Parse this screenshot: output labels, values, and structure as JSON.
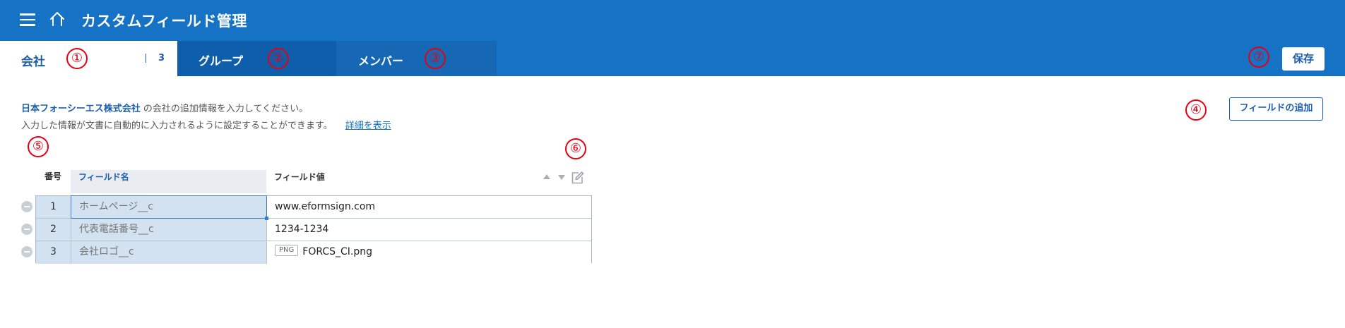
{
  "header": {
    "title": "カスタムフィールド管理"
  },
  "tabs": [
    {
      "label": "会社",
      "count": "3"
    },
    {
      "label": "グループ"
    },
    {
      "label": "メンバー"
    }
  ],
  "markers": [
    "①",
    "②",
    "③",
    "④",
    "⑤",
    "⑥",
    "⑦"
  ],
  "actions": {
    "save_label": "保存",
    "add_field_label": "フィールドの追加"
  },
  "description": {
    "company_name": "日本フォーシーエス株式会社",
    "line1_rest": " の会社の追加情報を入力してください。",
    "line2": "入力した情報が文書に自動的に入力されるように設定することができます。",
    "details_link": "詳細を表示"
  },
  "table": {
    "columns": {
      "number": "番号",
      "field_name": "フィールド名",
      "field_value": "フィールド値"
    },
    "rows": [
      {
        "no": "1",
        "name": "ホームページ__c",
        "value": "www.eformsign.com"
      },
      {
        "no": "2",
        "name": "代表電話番号__c",
        "value": "1234-1234"
      },
      {
        "no": "3",
        "name": "会社ロゴ__c",
        "badge": "PNG",
        "value": "FORCS_CI.png"
      }
    ]
  },
  "icons": [
    "menu-icon",
    "home-icon",
    "sort-up-icon",
    "sort-down-icon",
    "edit-icon",
    "remove-row-icon",
    "png-file-icon"
  ],
  "colors": {
    "header_bg": "#1572c4",
    "tab_group_bg": "#0e5eab",
    "accent": "#1d5fae",
    "annotation": "#e60012",
    "row_highlight": "#d3e2f0"
  }
}
